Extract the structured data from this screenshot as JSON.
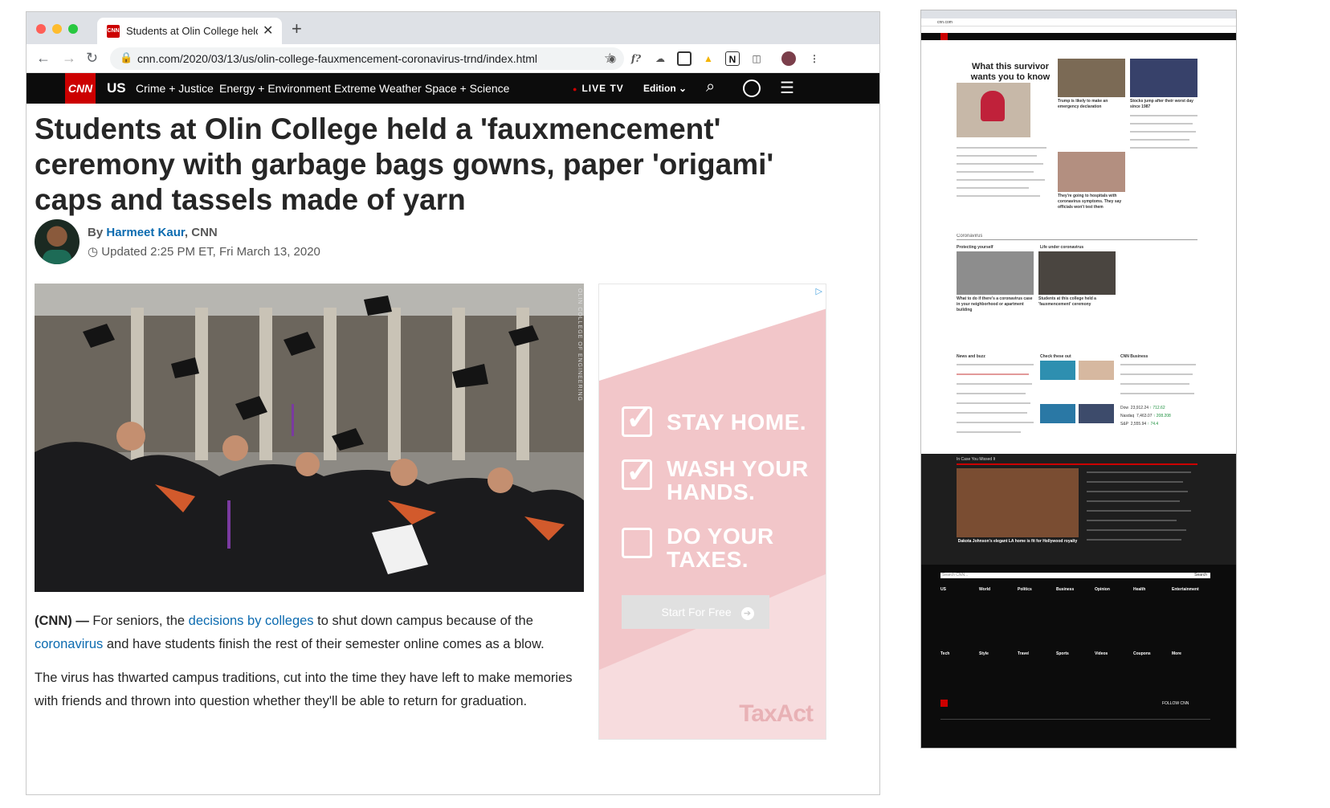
{
  "browser": {
    "tab_title": "Students at Olin College held a",
    "tab_favicon": "CNN",
    "url": "cnn.com/2020/03/13/us/olin-college-fauxmencement-coronavirus-trnd/index.html",
    "toolbar_icons": [
      "back-icon",
      "forward-icon",
      "reload-icon",
      "lock-icon",
      "star-icon",
      "camera-icon",
      "fx-icon",
      "cloud-icon",
      "square-icon",
      "drive-icon",
      "notion-icon",
      "puzzle-icon",
      "profile-avatar",
      "kebab-menu-icon"
    ],
    "colors": {
      "close": "#ff5f57",
      "minimize": "#febc2e",
      "maximize": "#28c840"
    }
  },
  "cnn_nav": {
    "logo": "CNN",
    "section": "US",
    "links": [
      "Crime + Justice",
      "Energy + Environment",
      "Extreme Weather",
      "Space + Science"
    ],
    "live_tv": "LIVE TV",
    "edition": "Edition",
    "accent": "#cc0000"
  },
  "article": {
    "headline": "Students at Olin College held a 'fauxmencement' ceremony with garbage bags gowns, paper 'origami' caps and tassels made of yarn",
    "by_prefix": "By",
    "author": "Harmeet Kaur",
    "outlet": ", CNN",
    "updated": "Updated 2:25 PM ET, Fri March 13, 2020",
    "photo_credit": "OLIN COLLEGE OF ENGINEERING",
    "p1": {
      "dateline": "(CNN) —",
      "t1": " For seniors, the ",
      "link1": "decisions by colleges",
      "t2": " to shut down campus because of the ",
      "link2": "coronavirus",
      "t3": " and have students finish the rest of their semester online comes as a blow."
    },
    "p2": "The virus has thwarted campus traditions, cut into the time they have left to make memories with friends and thrown into question whether they'll be able to return for graduation."
  },
  "ad": {
    "items": [
      {
        "label": "STAY HOME.",
        "checked": true
      },
      {
        "label": "WASH YOUR HANDS.",
        "checked": true
      },
      {
        "label": "DO YOUR TAXES.",
        "checked": false
      }
    ],
    "button": "Start For Free",
    "brand": "TaxAct",
    "adchoices": "▷",
    "colors": {
      "band": "#f2c6c9",
      "button": "#dcdcdc"
    }
  },
  "mini_page": {
    "url": "cnn.com",
    "top_headline": "What this survivor wants you to know",
    "story2": "Trump is likely to make an emergency declaration",
    "story3": "Stocks jump after their worst day since 1987",
    "story4": "They're going to hospitals with coronavirus symptoms. They say officials won't test them",
    "section_coronavirus": "Coronavirus",
    "sub_protecting": "Protecting yourself",
    "sub_life": "Life under coronavirus",
    "cap_neighborhood": "What to do if there's a coronavirus case in your neighborhood or apartment building",
    "cap_college": "Students at this college held a 'fauxmencement' ceremony",
    "news_buzz": "News and buzz",
    "check_these": "Check these out",
    "cnn_business": "CNN Business",
    "markets": [
      {
        "name": "Dow",
        "value": "23,912.24",
        "change": "↑ 712.62"
      },
      {
        "name": "Nasdaq",
        "value": "7,463.07",
        "change": "↑ 208.208"
      },
      {
        "name": "S&P",
        "value": "2,555.94",
        "change": "↑ 74.4"
      }
    ],
    "missed": "In Case You Missed It",
    "missed_caption": "Dakota Johnson's elegant LA home is fit for Hollywood royalty",
    "footer_cols": [
      "US",
      "World",
      "Politics",
      "Business",
      "Opinion",
      "Health",
      "Entertainment",
      "Tech",
      "Style",
      "Travel",
      "Sports",
      "Videos",
      "Coupons",
      "More"
    ],
    "search_placeholder": "Search CNN...",
    "search_btn": "Search",
    "follow": "FOLLOW CNN"
  }
}
